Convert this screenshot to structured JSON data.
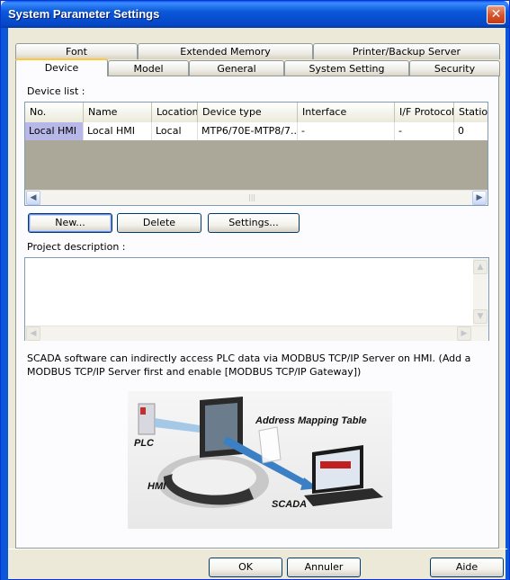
{
  "window": {
    "title": "System Parameter Settings",
    "close_glyph": "✕"
  },
  "tabs": {
    "row_back": [
      "Font",
      "Extended Memory",
      "Printer/Backup Server"
    ],
    "row_front": [
      "Device",
      "Model",
      "General",
      "System Setting",
      "Security"
    ],
    "active": "Device"
  },
  "device_list": {
    "label": "Device list :",
    "columns": [
      "No.",
      "Name",
      "Location",
      "Device type",
      "Interface",
      "I/F Protocol",
      "Station"
    ],
    "rows": [
      [
        "Local HMI",
        "Local HMI",
        "Local",
        "MTP6/70E-MTP8/7...",
        "-",
        "-",
        "0"
      ]
    ],
    "scroll_grip": "|||"
  },
  "buttons": {
    "new": "New...",
    "delete": "Delete",
    "settings": "Settings..."
  },
  "project_description": {
    "label": "Project description :",
    "value": ""
  },
  "note": "SCADA software can indirectly access PLC data via MODBUS TCP/IP Server on HMI. (Add a MODBUS TCP/IP Server first and enable [MODBUS TCP/IP Gateway])",
  "diagram": {
    "address_mapping_table": "Address Mapping Table",
    "plc": "PLC",
    "hmi": "HMI",
    "scada": "SCADA"
  },
  "footer": {
    "ok": "OK",
    "cancel": "Annuler",
    "help": "Aide"
  },
  "colors": {
    "titlebar": "#0a58d8",
    "selected_cell": "#b8b8e8",
    "active_tab_accent": "#ffc83c"
  }
}
